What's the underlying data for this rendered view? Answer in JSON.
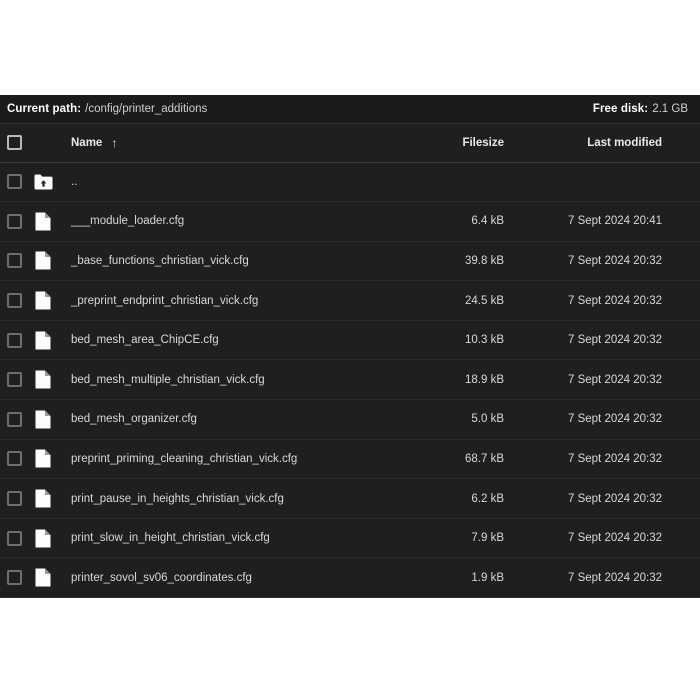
{
  "pathbar": {
    "path_label": "Current path:",
    "path_value": "/config/printer_additions",
    "disk_label": "Free disk:",
    "disk_value": "2.1 GB"
  },
  "table": {
    "headers": {
      "name": "Name",
      "sort_indicator": "↑",
      "filesize": "Filesize",
      "last_modified": "Last modified"
    },
    "parent_row": {
      "name": "..",
      "icon": "folder-up-icon",
      "filesize": "",
      "last_modified": ""
    },
    "rows": [
      {
        "icon": "file-icon",
        "name": "___module_loader.cfg",
        "filesize": "6.4 kB",
        "last_modified": "7 Sept 2024 20:41"
      },
      {
        "icon": "file-icon",
        "name": "_base_functions_christian_vick.cfg",
        "filesize": "39.8 kB",
        "last_modified": "7 Sept 2024 20:32"
      },
      {
        "icon": "file-icon",
        "name": "_preprint_endprint_christian_vick.cfg",
        "filesize": "24.5 kB",
        "last_modified": "7 Sept 2024 20:32"
      },
      {
        "icon": "file-icon",
        "name": "bed_mesh_area_ChipCE.cfg",
        "filesize": "10.3 kB",
        "last_modified": "7 Sept 2024 20:32"
      },
      {
        "icon": "file-icon",
        "name": "bed_mesh_multiple_christian_vick.cfg",
        "filesize": "18.9 kB",
        "last_modified": "7 Sept 2024 20:32"
      },
      {
        "icon": "file-icon",
        "name": "bed_mesh_organizer.cfg",
        "filesize": "5.0 kB",
        "last_modified": "7 Sept 2024 20:32"
      },
      {
        "icon": "file-icon",
        "name": "preprint_priming_cleaning_christian_vick.cfg",
        "filesize": "68.7 kB",
        "last_modified": "7 Sept 2024 20:32"
      },
      {
        "icon": "file-icon",
        "name": "print_pause_in_heights_christian_vick.cfg",
        "filesize": "6.2 kB",
        "last_modified": "7 Sept 2024 20:32"
      },
      {
        "icon": "file-icon",
        "name": "print_slow_in_height_christian_vick.cfg",
        "filesize": "7.9 kB",
        "last_modified": "7 Sept 2024 20:32"
      },
      {
        "icon": "file-icon",
        "name": "printer_sovol_sv06_coordinates.cfg",
        "filesize": "1.9 kB",
        "last_modified": "7 Sept 2024 20:32"
      }
    ]
  },
  "colors": {
    "panel_background": "#1f1f1f",
    "pathbar_background": "#1b1b1b",
    "row_separator": "#2b2b2b",
    "text_primary": "#d8d8d8",
    "text_strong": "#ffffff",
    "page_background": "#ffffff"
  }
}
